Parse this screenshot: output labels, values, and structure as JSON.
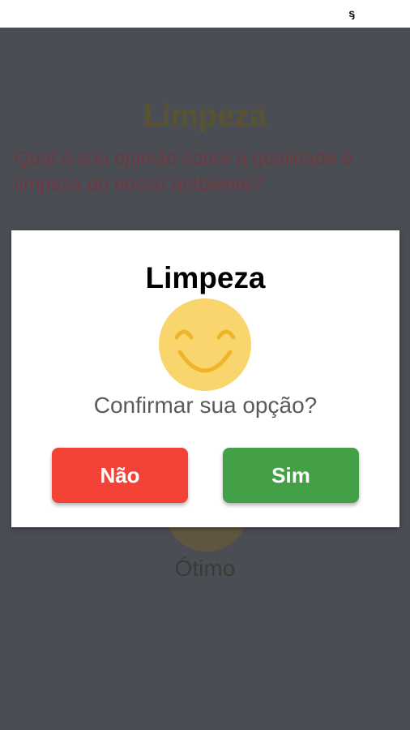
{
  "status_bar": {
    "glyph": "ᶊ"
  },
  "background": {
    "title": "Limpeza",
    "question": "Qual a sua opinião sobre a qualidade e limpeza do nosso ambiente?",
    "option_label": "Ótimo"
  },
  "dialog": {
    "title": "Limpeza",
    "icon": "smiley-face-icon",
    "question": "Confirmar sua opção?",
    "no_label": "Não",
    "yes_label": "Sim"
  },
  "colors": {
    "overlay": "#4b4d55",
    "no_button": "#f44336",
    "yes_button": "#43a047",
    "smiley": "#f9d56e",
    "smiley_stroke": "#f0b429"
  }
}
